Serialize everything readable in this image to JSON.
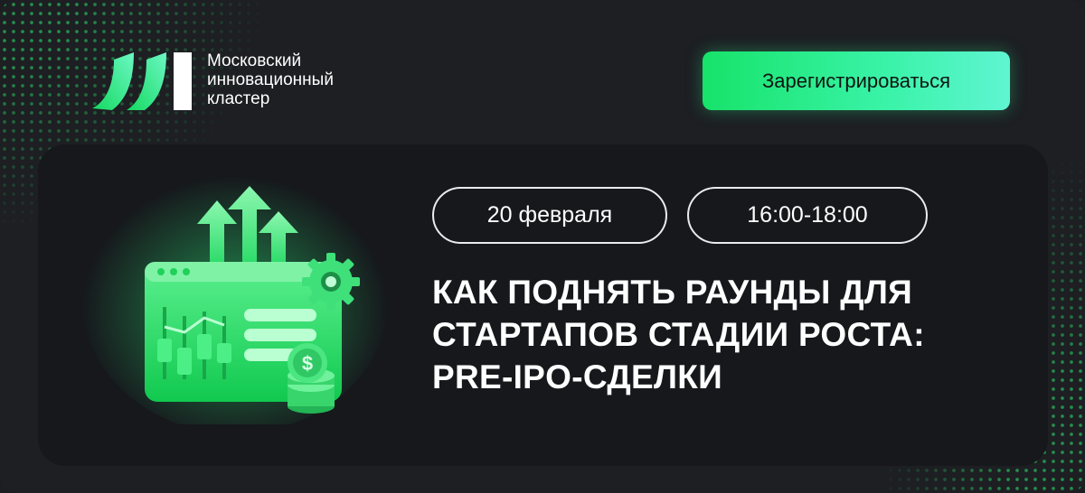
{
  "logo": {
    "icon": "moscow-innovation-cluster-logo",
    "lines": [
      "Московский",
      "инновационный",
      "кластер"
    ]
  },
  "header": {
    "register_label": "Зарегистрироваться"
  },
  "event": {
    "date": "20 февраля",
    "time": "16:00-18:00",
    "title_lines": [
      "КАК ПОДНЯТЬ РАУНДЫ ДЛЯ",
      "СТАРТАПОВ СТАДИИ РОСТА:",
      "PRE-IPO-СДЕЛКИ"
    ]
  },
  "illustration": {
    "icon": "growth-dashboard-icon",
    "currency_symbol": "$"
  },
  "colors": {
    "accent": "#17e36a",
    "accent_light": "#5ff5d2",
    "background": "#1d1f23",
    "card": "#16181c",
    "text": "#ffffff"
  }
}
